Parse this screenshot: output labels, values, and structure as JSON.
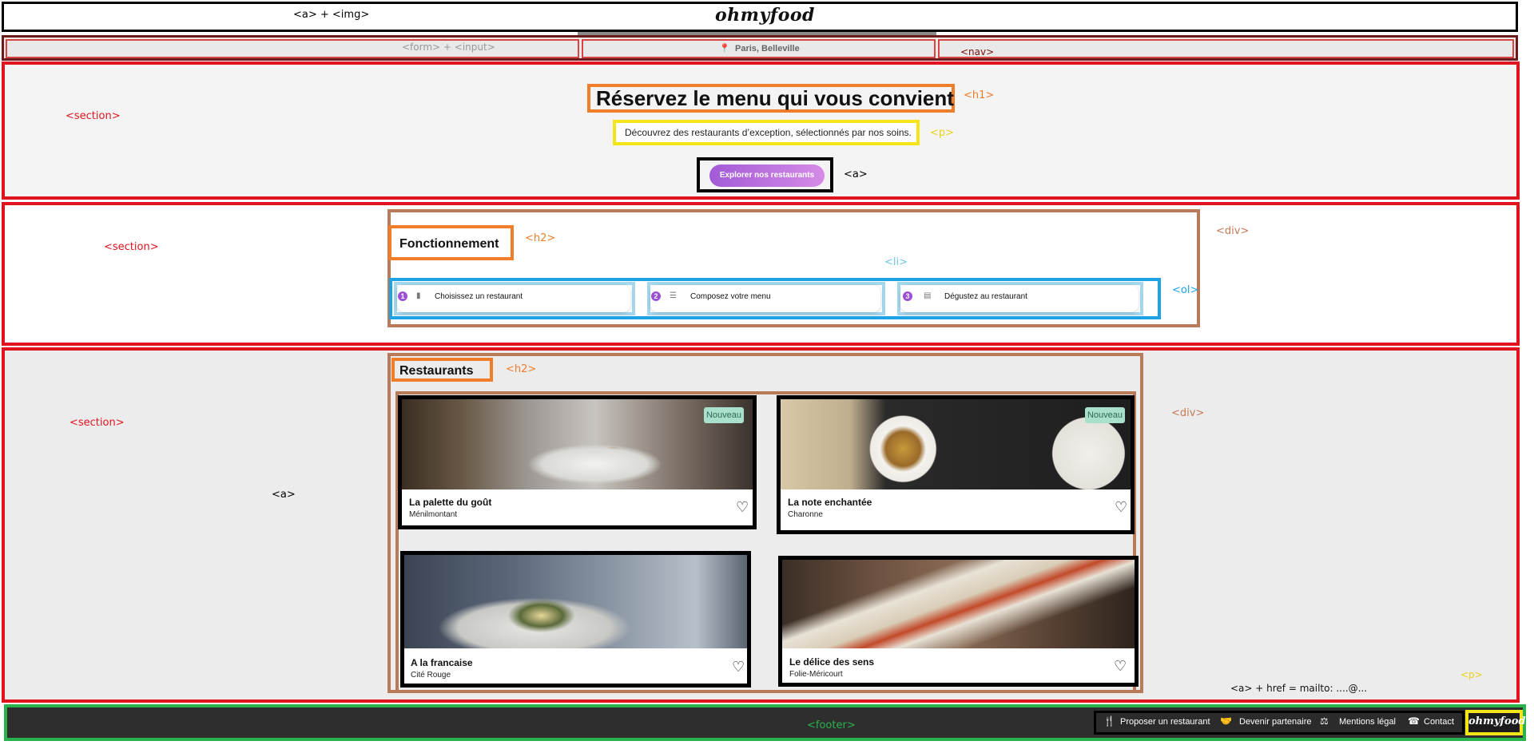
{
  "header": {
    "annotation": "<a> + <img>",
    "logo": "ohmyfood"
  },
  "form_row": {
    "annotation_form": "<form> + <input>",
    "location": "Paris, Belleville",
    "annotation_nav": "<nav>"
  },
  "hero": {
    "annotation_section": "<section>",
    "title": "Réservez le menu qui vous convient",
    "annotation_h1": "<h1>",
    "subtitle": "Découvrez des restaurants d’exception, sélectionnés par nos soins.",
    "annotation_p": "<p>",
    "cta_label": "Explorer nos restaurants",
    "annotation_a": "<a>"
  },
  "how_it_works": {
    "annotation_section": "<section>",
    "title": "Fonctionnement",
    "annotation_h2": "<h2>",
    "annotation_div": "<div>",
    "annotation_li": "<li>",
    "annotation_ol": "<ol>",
    "steps": [
      {
        "number": "1",
        "icon": "phone-icon",
        "label": "Choisissez un restaurant"
      },
      {
        "number": "2",
        "icon": "list-icon",
        "label": "Composez votre menu"
      },
      {
        "number": "3",
        "icon": "store-icon",
        "label": "Dégustez au restaurant"
      }
    ]
  },
  "restaurants": {
    "annotation_section": "<section>",
    "title": "Restaurants",
    "annotation_h2": "<h2>",
    "annotation_div": "<div>",
    "annotation_a": "<a>",
    "badge_label": "Nouveau",
    "items": [
      {
        "name": "La palette du goût",
        "location": "Ménilmontant",
        "is_new": true
      },
      {
        "name": "La note enchantée",
        "location": "Charonne",
        "is_new": true
      },
      {
        "name": "A la francaise",
        "location": "Cité Rouge",
        "is_new": false
      },
      {
        "name": "Le délice des sens",
        "location": "Folie-Méricourt",
        "is_new": false
      }
    ]
  },
  "footer": {
    "annotation_footer": "<footer>",
    "annotation_mailto": "<a> + href = mailto: ....@...",
    "annotation_p": "<p>",
    "links": [
      {
        "icon": "utensils-icon",
        "label": "Proposer un restaurant"
      },
      {
        "icon": "handshake-icon",
        "label": "Devenir partenaire"
      },
      {
        "icon": "scale-icon",
        "label": "Mentions légal"
      },
      {
        "icon": "phone-icon",
        "label": "Contact"
      }
    ],
    "logo": "ohmyfood"
  },
  "colors": {
    "section_border": "#e0141e",
    "h_border": "#f07d2a",
    "p_border": "#f3e51a",
    "div_border": "#b87a59",
    "ol_border": "#1ea2e6",
    "li_border": "#a4d6ec",
    "footer_border": "#2ab34d",
    "cta_gradient_start": "#a25bd6",
    "cta_gradient_end": "#d58be6",
    "badge_bg": "#a8e0cb"
  }
}
